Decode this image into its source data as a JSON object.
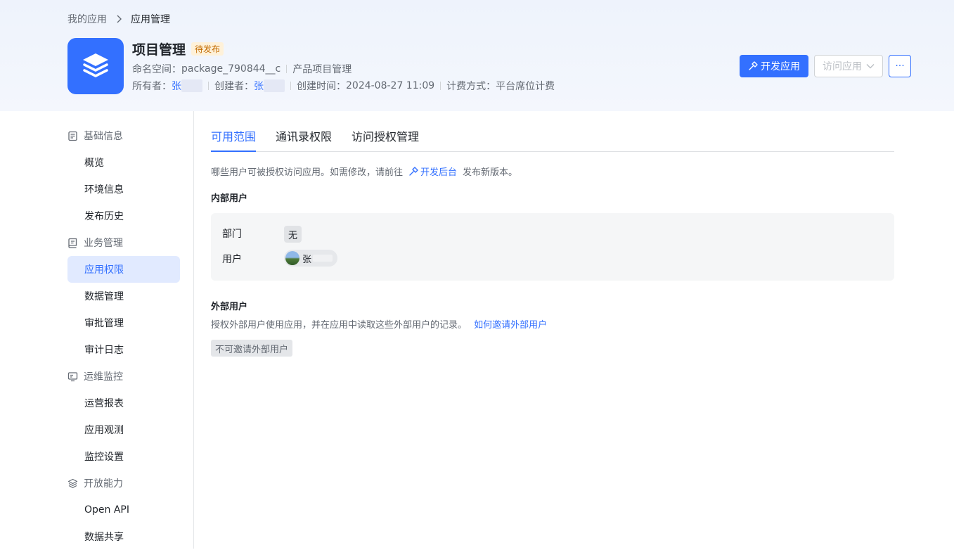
{
  "breadcrumb": {
    "parent": "我的应用",
    "current": "应用管理"
  },
  "app": {
    "name": "项目管理",
    "status": "待发布",
    "namespace_label": "命名空间：",
    "namespace_value": "package_790844__c",
    "description": "产品项目管理",
    "owner_label": "所有者：",
    "owner": "张",
    "creator_label": "创建者：",
    "creator": "张",
    "created_time_label": "创建时间：",
    "created_time": "2024-08-27 11:09",
    "billing_label": "计费方式：",
    "billing": "平台席位计费"
  },
  "actions": {
    "develop": "开发应用",
    "visit": "访问应用",
    "more": "···"
  },
  "sidebar": {
    "groups": [
      {
        "label": "基础信息",
        "icon": "document-icon",
        "items": [
          "概览",
          "环境信息",
          "发布历史"
        ]
      },
      {
        "label": "业务管理",
        "icon": "book-icon",
        "items": [
          "应用权限",
          "数据管理",
          "审批管理",
          "审计日志"
        ]
      },
      {
        "label": "运维监控",
        "icon": "monitor-icon",
        "items": [
          "运营报表",
          "应用观测",
          "监控设置"
        ]
      },
      {
        "label": "开放能力",
        "icon": "layers-icon",
        "items": [
          "Open API",
          "数据共享"
        ]
      }
    ],
    "active": "应用权限"
  },
  "tabs": [
    "可用范围",
    "通讯录权限",
    "访问授权管理"
  ],
  "active_tab": "可用范围",
  "scope": {
    "desc_prefix": "哪些用户可被授权访问应用。如需修改，请前往",
    "desc_link": "开发后台",
    "desc_suffix": "发布新版本。",
    "internal_title": "内部用户",
    "dept_label": "部门",
    "dept_value": "无",
    "user_label": "用户",
    "user_value": "张",
    "external_title": "外部用户",
    "external_desc": "授权外部用户使用应用，并在应用中读取这些外部用户的记录。",
    "external_link": "如何邀请外部用户",
    "external_status": "不可邀请外部用户"
  },
  "colors": {
    "primary": "#3370ff",
    "badge_bg": "#fef1d9",
    "badge_text": "#c26a00"
  }
}
